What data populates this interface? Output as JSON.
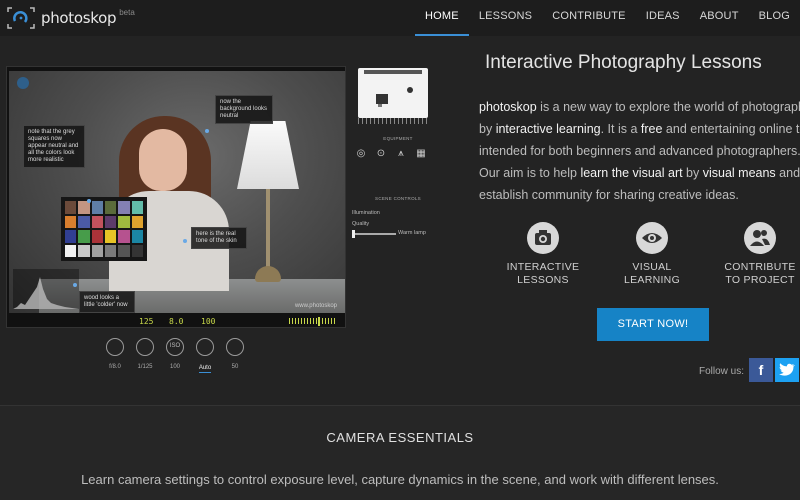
{
  "brand": {
    "name": "photoskop",
    "badge": "beta"
  },
  "nav": {
    "items": [
      "HOME",
      "LESSONS",
      "CONTRIBUTE",
      "IDEAS",
      "ABOUT",
      "BLOG"
    ],
    "active": "HOME"
  },
  "simulator": {
    "notes": [
      "now the background looks neutral",
      "note that the grey squares now appear neutral and all the colors look more realistic",
      "here is the real tone of the skin",
      "wood looks a little 'colder' now"
    ],
    "watermark": "www.photoskop",
    "readout": {
      "shutter": "125",
      "aperture": "8.0",
      "iso": "100"
    },
    "checker_colors": [
      "#6b4a3a",
      "#c39582",
      "#5f7ea6",
      "#5b6b3b",
      "#8480b3",
      "#62bca9",
      "#d87e2e",
      "#4b5aa6",
      "#c2525d",
      "#5d3b6b",
      "#a0bb3f",
      "#e0a32e",
      "#313f93",
      "#479c4a",
      "#ab3339",
      "#e7c326",
      "#b6528f",
      "#1b86a3",
      "#f2f2f2",
      "#c8c8c8",
      "#a0a0a0",
      "#7a7a7a",
      "#555555",
      "#343434"
    ],
    "controls": [
      {
        "value": "f/8.0",
        "icon": "aperture-icon"
      },
      {
        "value": "1/125",
        "icon": "shutter-icon"
      },
      {
        "value": "100",
        "icon": "iso-icon",
        "glyph": "ISO"
      },
      {
        "value": "Auto",
        "icon": "white-balance-icon",
        "active": true
      },
      {
        "value": "50",
        "icon": "lens-icon"
      }
    ]
  },
  "side_panel": {
    "equipment_title": "EQUIPMENT",
    "equipment": [
      "camera-icon",
      "camera-body-icon",
      "tripod-icon",
      "color-checker-icon"
    ],
    "scene_title": "SCENE CONTROLS",
    "illumination_label": "Illumination",
    "quality_label": "Quality",
    "slider_value": "Warm lamp"
  },
  "hero": {
    "headline": "Interactive Photography Lessons",
    "intro_lines": [
      [
        {
          "t": "photoskop",
          "h": true
        },
        {
          "t": " is a new way to explore the world of photography",
          "h": false
        }
      ],
      [
        {
          "t": "by ",
          "h": false
        },
        {
          "t": "interactive learning",
          "h": true
        },
        {
          "t": ". It is a ",
          "h": false
        },
        {
          "t": "free",
          "h": true
        },
        {
          "t": " and entertaining online tool",
          "h": false
        }
      ],
      [
        {
          "t": "intended for both beginners and advanced photographers.",
          "h": false
        }
      ],
      [
        {
          "t": "Our aim is to help ",
          "h": false
        },
        {
          "t": "learn the visual art",
          "h": true
        },
        {
          "t": " by ",
          "h": false
        },
        {
          "t": "visual means",
          "h": true
        },
        {
          "t": " and to",
          "h": false
        }
      ],
      [
        {
          "t": "establish community for sharing creative ideas.",
          "h": false
        }
      ]
    ]
  },
  "features": [
    {
      "line1": "INTERACTIVE",
      "line2": "LESSONS",
      "icon": "camera-icon"
    },
    {
      "line1": "VISUAL",
      "line2": "LEARNING",
      "icon": "eye-icon"
    },
    {
      "line1": "CONTRIBUTE",
      "line2": "TO PROJECT",
      "icon": "users-icon"
    }
  ],
  "cta": {
    "label": "START NOW!"
  },
  "social": {
    "label": "Follow us:",
    "facebook_color": "#3b5998",
    "twitter_color": "#1da1f2"
  },
  "section": {
    "title": "CAMERA ESSENTIALS",
    "subtitle": "Learn camera settings to control exposure level, capture dynamics in the scene, and work with different lenses."
  },
  "colors": {
    "accent": "#1683c6",
    "background": "#232323"
  }
}
